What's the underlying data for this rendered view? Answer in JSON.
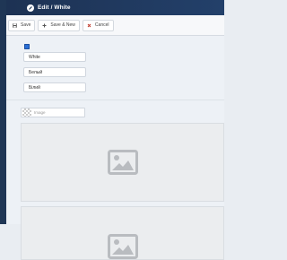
{
  "header": {
    "title": "Edit / White",
    "icon": "edit-icon",
    "background": "#1d3253"
  },
  "toolbar": {
    "save_label": "Save",
    "save_new_label": "Save & New",
    "cancel_label": "Cancel",
    "save_icon": "floppy-disk-icon",
    "save_new_icon": "plus-icon",
    "cancel_icon": "close-icon",
    "cancel_icon_color": "#c0392b"
  },
  "form": {
    "checkbox_checked": true,
    "checkbox_color": "#2b6fd6",
    "fields": [
      {
        "value": "White"
      },
      {
        "value": "Белый"
      },
      {
        "value": "Білий"
      }
    ]
  },
  "image_field": {
    "placeholder": "Image"
  },
  "images": [
    {
      "icon": "image-placeholder-icon"
    },
    {
      "icon": "image-placeholder-icon"
    }
  ]
}
